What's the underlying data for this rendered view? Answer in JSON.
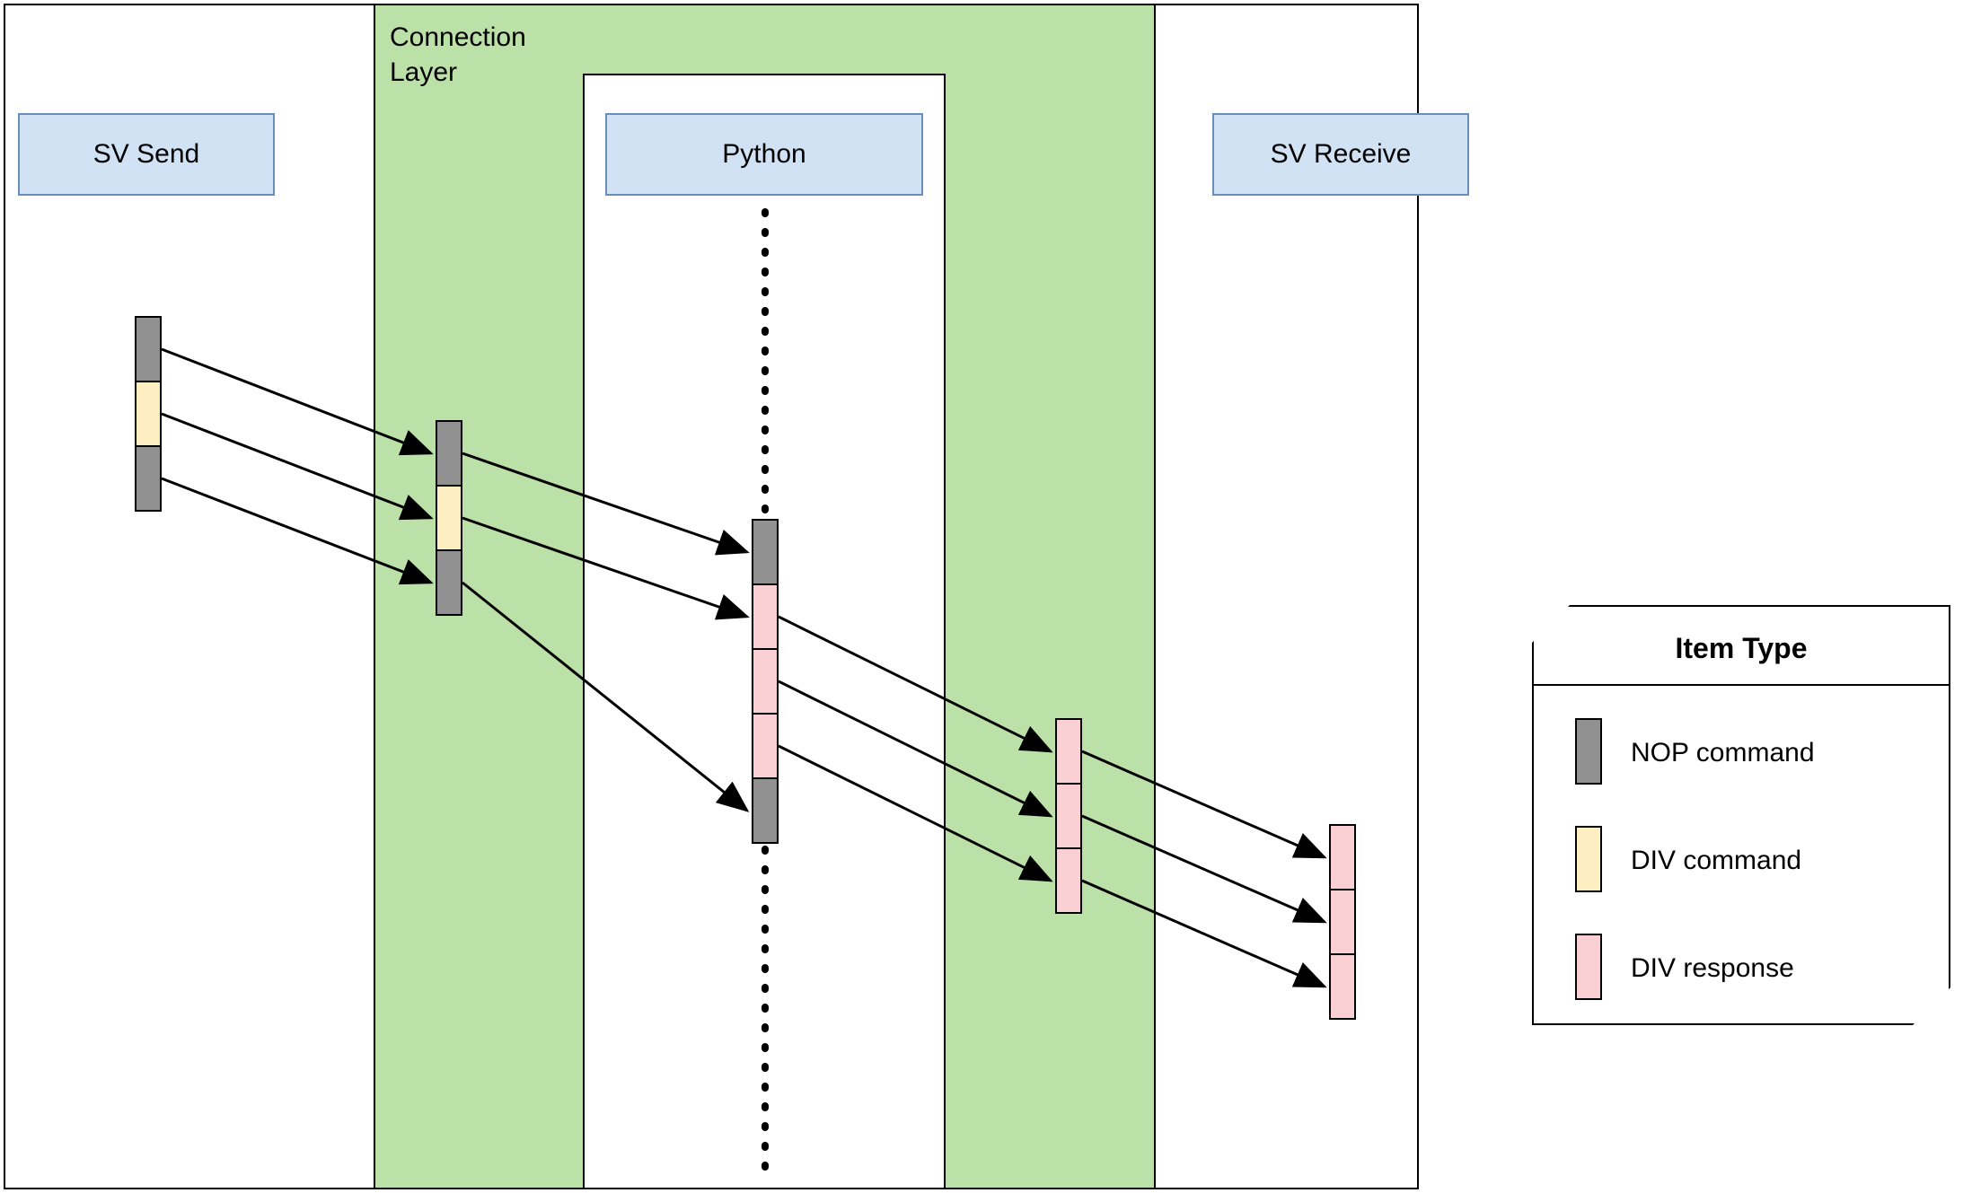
{
  "headers": {
    "sv_send": "SV Send",
    "python": "Python",
    "sv_receive": "SV Receive"
  },
  "connection_layer_label": "Connection\nLayer",
  "legend": {
    "title": "Item Type",
    "items": [
      {
        "color": "grey",
        "label": "NOP command"
      },
      {
        "color": "yellow",
        "label": "DIV command"
      },
      {
        "color": "pink",
        "label": "DIV response"
      }
    ]
  },
  "colors": {
    "grey": "#919191",
    "yellow": "#ffeec1",
    "pink": "#fbd0d4",
    "blue": "#d0e2f3",
    "green": "#bbe0a8"
  },
  "diagram": {
    "stacks": {
      "sv_send": [
        "grey",
        "yellow",
        "grey"
      ],
      "conn_in": [
        "grey",
        "yellow",
        "grey"
      ],
      "python_seq": [
        "grey",
        "pink",
        "pink",
        "pink",
        "grey"
      ],
      "conn_out": [
        "pink",
        "pink",
        "pink"
      ],
      "sv_receive": [
        "pink",
        "pink",
        "pink"
      ]
    },
    "arrows": [
      {
        "from": "sv_send_stack",
        "to": "conn_in_stack",
        "count": 3
      },
      {
        "from": "conn_in_stack",
        "to": "python_seq",
        "map": [
          [
            0,
            0
          ],
          [
            1,
            1
          ],
          [
            2,
            4
          ]
        ]
      },
      {
        "from": "python_seq",
        "to": "conn_out_stack",
        "map": [
          [
            1,
            0
          ],
          [
            2,
            1
          ],
          [
            3,
            2
          ]
        ]
      },
      {
        "from": "conn_out_stack",
        "to": "sv_receive_stack",
        "count": 3
      }
    ]
  }
}
